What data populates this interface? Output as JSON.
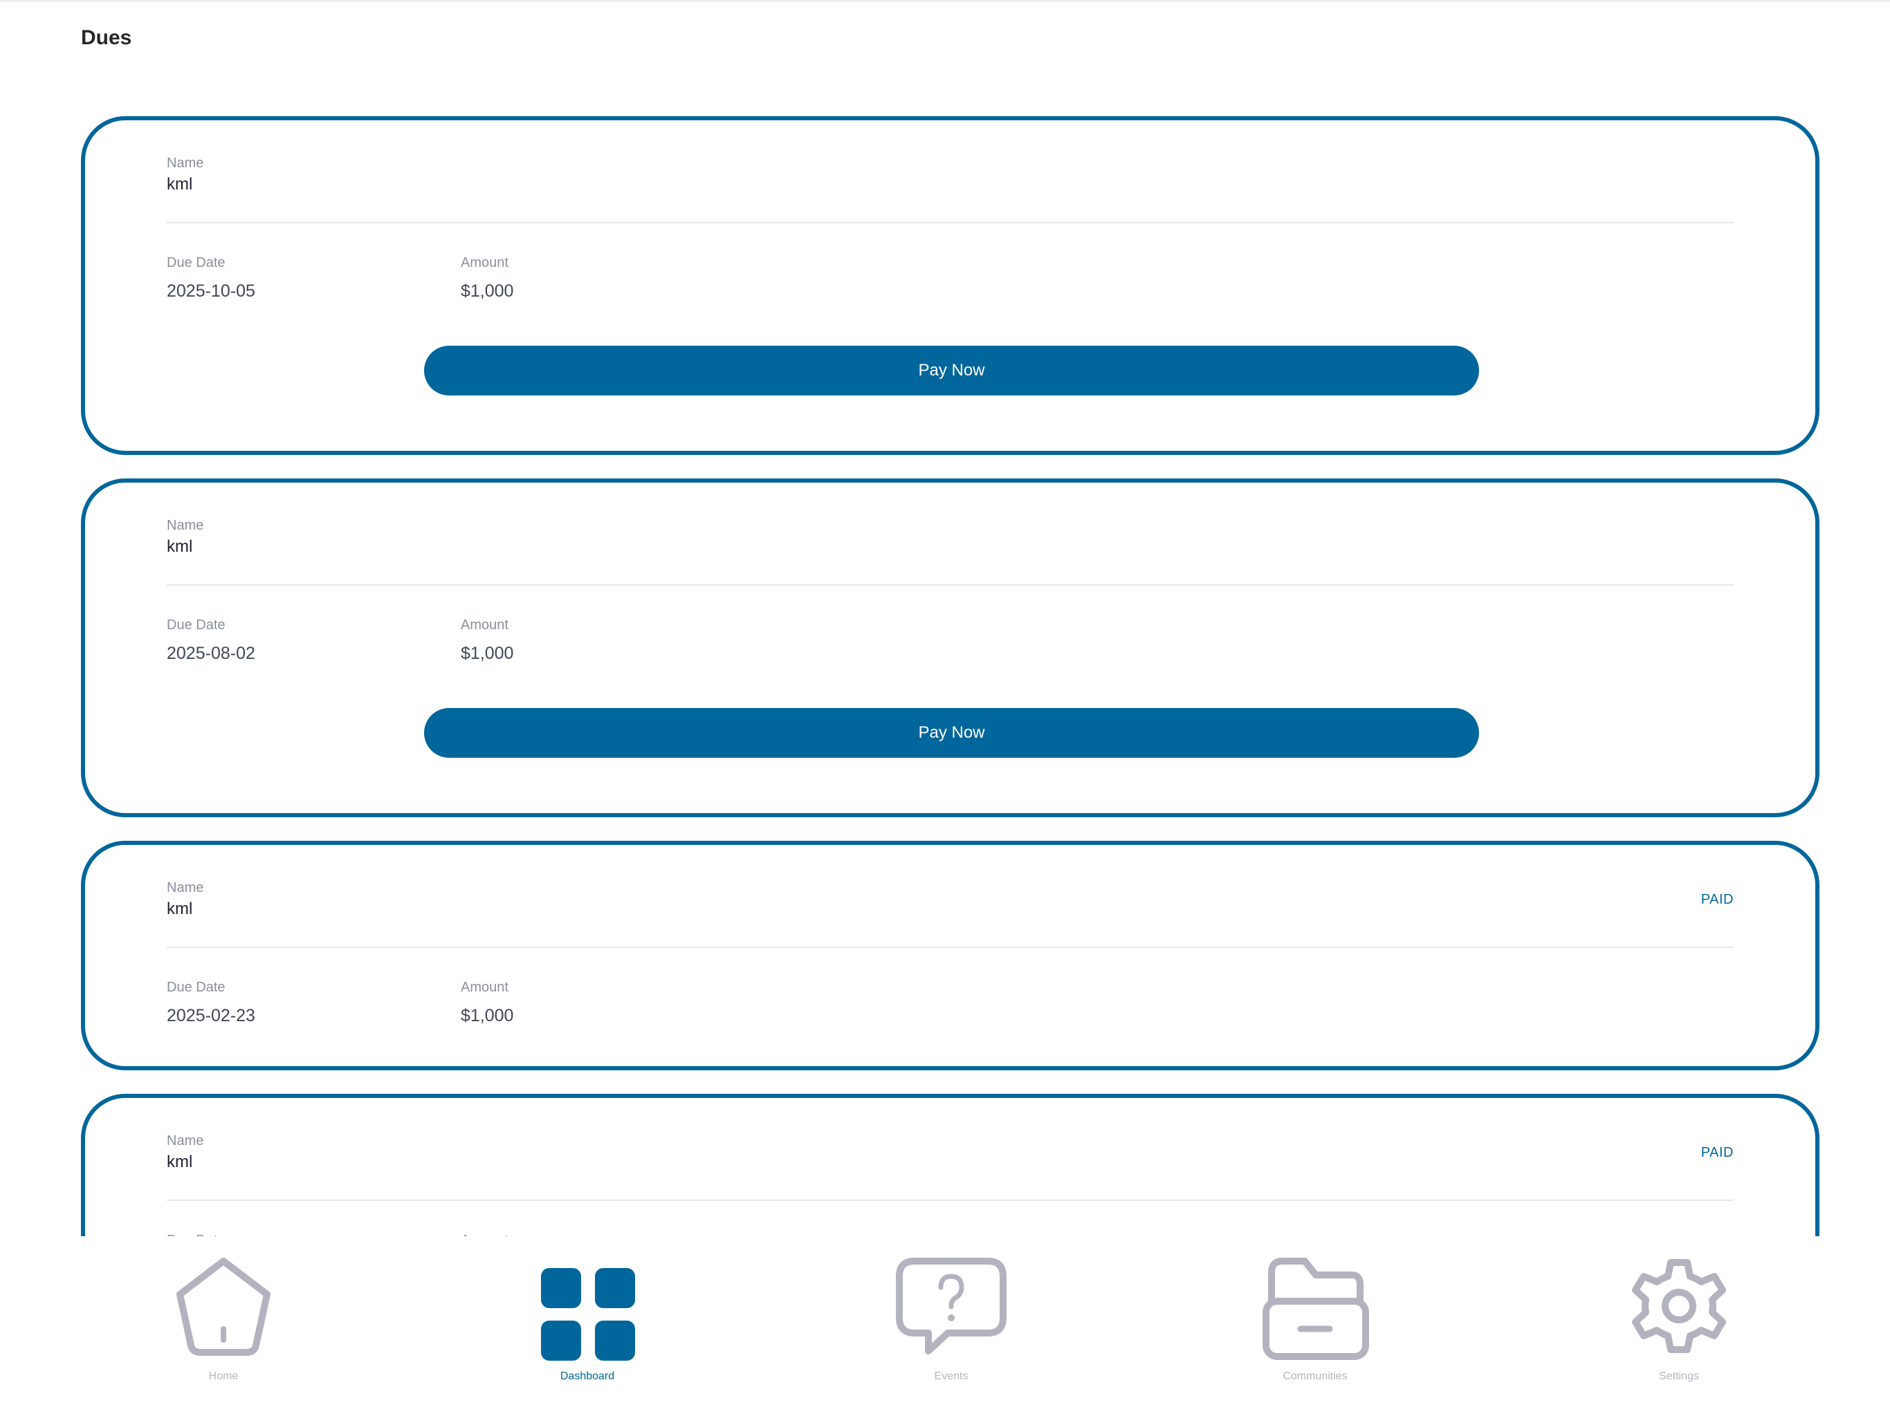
{
  "header": {
    "title": "Dues"
  },
  "labels": {
    "name": "Name",
    "due_date": "Due Date",
    "amount": "Amount",
    "pay_now": "Pay Now"
  },
  "dues": [
    {
      "name": "kml",
      "due_date": "2025-10-05",
      "amount": "$1,000",
      "status": "",
      "action": "Pay Now"
    },
    {
      "name": "kml",
      "due_date": "2025-08-02",
      "amount": "$1,000",
      "status": "",
      "action": "Pay Now"
    },
    {
      "name": "kml",
      "due_date": "2025-02-23",
      "amount": "$1,000",
      "status": "PAID"
    },
    {
      "name": "kml",
      "status": "PAID"
    }
  ],
  "nav": {
    "items": [
      {
        "label": "Home",
        "icon": "home-icon"
      },
      {
        "label": "Dashboard",
        "icon": "grid-icon",
        "active": true
      },
      {
        "label": "Events",
        "icon": "question-chat-icon"
      },
      {
        "label": "Communities",
        "icon": "folder-icon"
      },
      {
        "label": "Settings",
        "icon": "gear-icon"
      }
    ]
  },
  "colors": {
    "accent": "#01669b",
    "inactive_icon": "#b3b3bf",
    "label_gray": "#8a8f9c"
  }
}
